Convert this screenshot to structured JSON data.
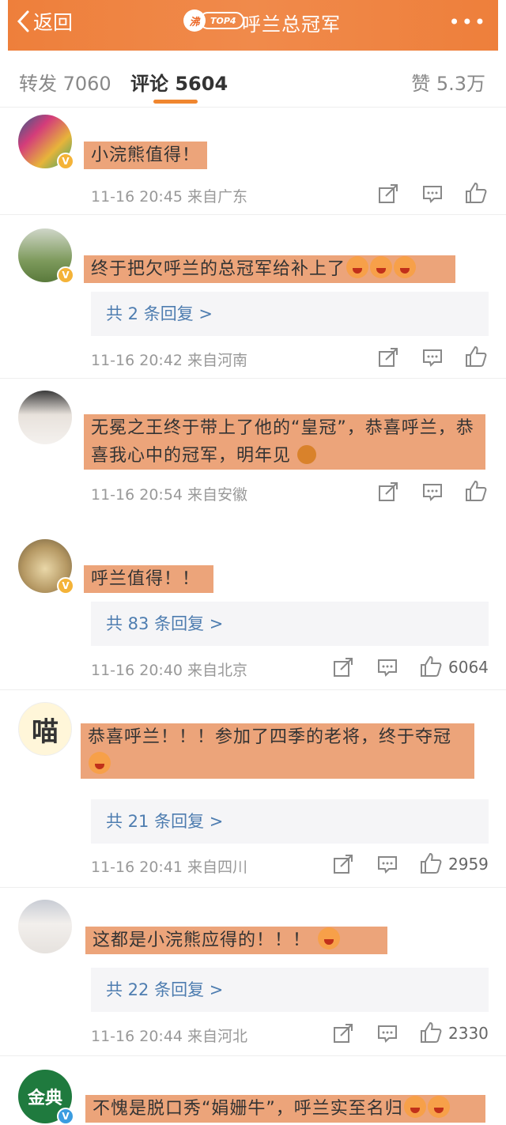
{
  "header": {
    "back_label": "返回",
    "hot_fei": "沸",
    "hot_rank": "TOP4",
    "title": "呼兰总冠军"
  },
  "tabs": {
    "repost": "转发 7060",
    "comment": "评论 5604",
    "like": "赞 5.3万"
  },
  "colors": {
    "accent": "#ee7f3b",
    "highlight": "#eca47a",
    "link": "#4e7db0"
  },
  "comments": [
    {
      "text": "小浣熊值得！",
      "meta": "11-16 20:45  来自广东",
      "like_count": ""
    },
    {
      "text": "终于把欠呼兰的总冠军给补上了",
      "reply": "共 2 条回复 >",
      "meta": "11-16 20:42  来自河南",
      "like_count": ""
    },
    {
      "text": "无冕之王终于带上了他的“皇冠”，恭喜呼兰，恭喜我心中的冠军，明年见",
      "meta": "11-16 20:54  来自安徽",
      "like_count": ""
    },
    {
      "text": "呼兰值得！！",
      "reply": "共 83 条回复 >",
      "meta": "11-16 20:40  来自北京",
      "like_count": "6064"
    },
    {
      "text": "恭喜呼兰！！！参加了四季的老将，终于夺冠",
      "reply": "共 21 条回复 >",
      "meta": "11-16 20:41  来自四川",
      "like_count": "2959"
    },
    {
      "text": "这都是小浣熊应得的！！！",
      "reply": "共 22 条回复 >",
      "meta": "11-16 20:44  来自河北",
      "like_count": "2330"
    },
    {
      "text": "不愧是脱口秀“娟姗牛”，呼兰实至名归"
    }
  ],
  "avatar_text": {
    "c5": "喵",
    "c7": "金典"
  }
}
